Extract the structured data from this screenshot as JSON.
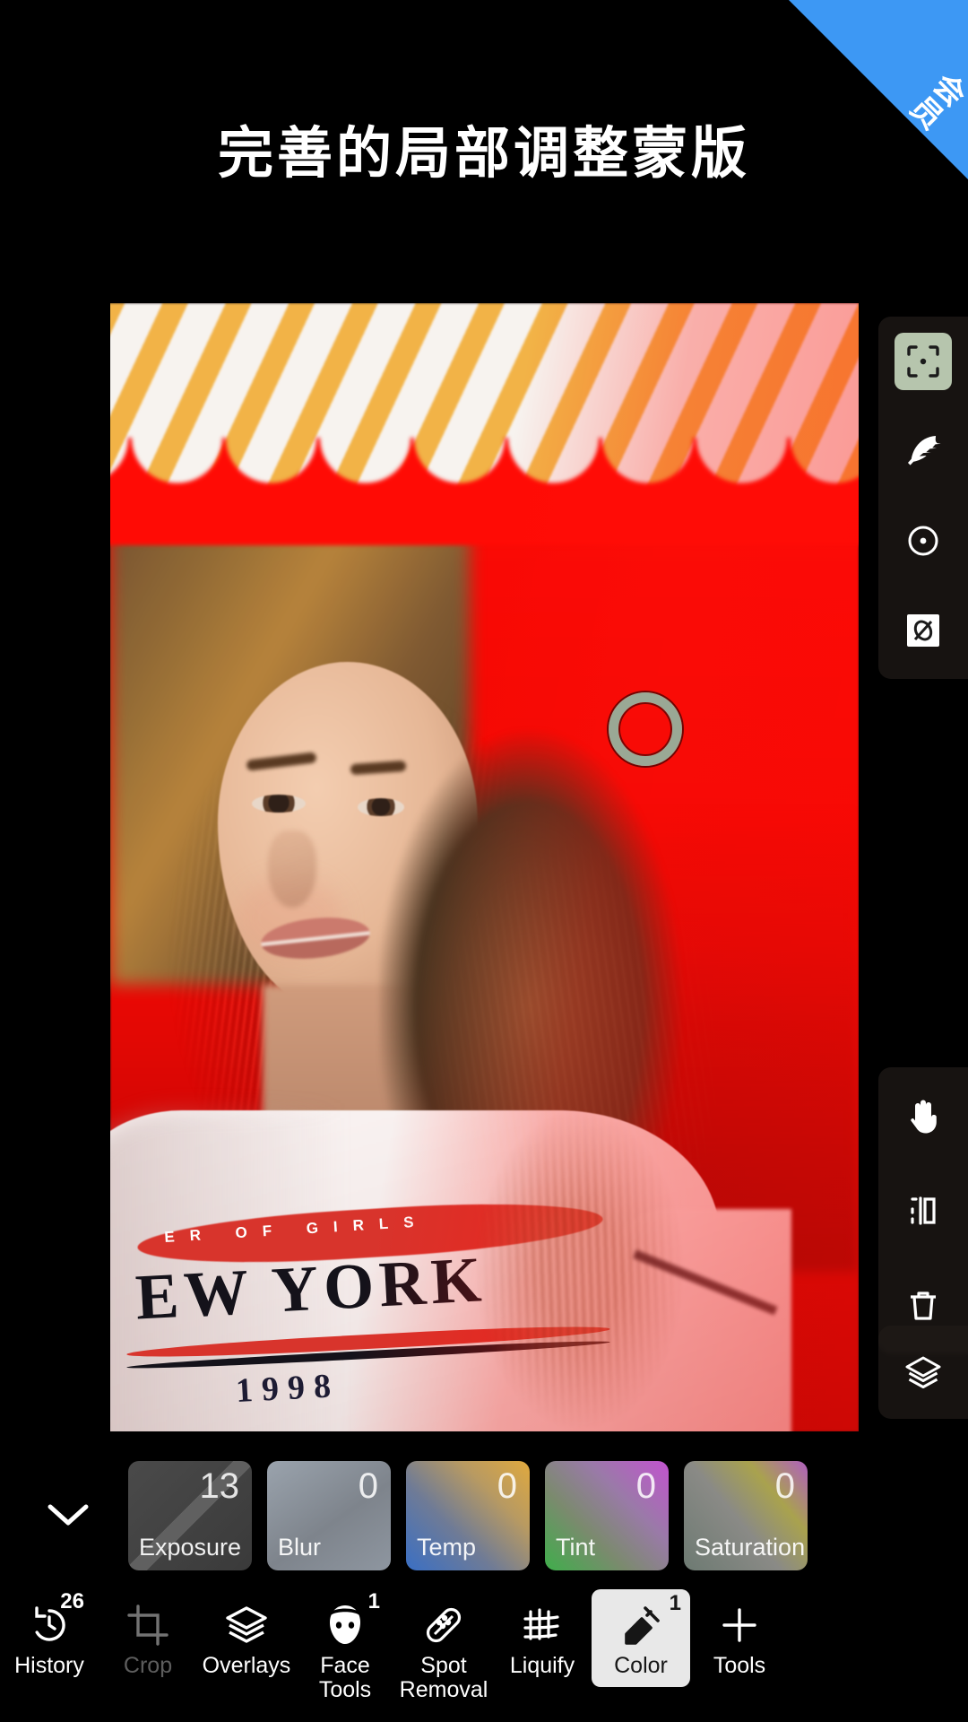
{
  "ribbon": {
    "label": "会员",
    "color": "#3d98f4"
  },
  "headline": {
    "text": "完善的局部调整蒙版"
  },
  "photo": {
    "tee_small_text": "ER OF GIRLS",
    "tee_main_text": "EW YORK",
    "tee_year": "1998"
  },
  "mask_toolbar": {
    "items": [
      {
        "name": "target-mask",
        "icon": "target-icon",
        "selected": true
      },
      {
        "name": "feather",
        "icon": "feather-icon",
        "selected": false
      },
      {
        "name": "radial-mask",
        "icon": "circle-dot-icon",
        "selected": false
      },
      {
        "name": "invert-mask",
        "icon": "invert-icon",
        "selected": false
      }
    ]
  },
  "transform_toolbar": {
    "items": [
      {
        "name": "pan",
        "icon": "hand-icon"
      },
      {
        "name": "mirror",
        "icon": "mirror-icon"
      },
      {
        "name": "delete",
        "icon": "trash-icon"
      }
    ]
  },
  "layers_button": {
    "name": "layers",
    "icon": "layers-icon"
  },
  "adjustments": {
    "collapse_icon": "chevron-down-icon",
    "cards": [
      {
        "label": "Exposure",
        "value": "13",
        "swatch": "exposure",
        "disabled": true
      },
      {
        "label": "Blur",
        "value": "0",
        "swatch": "blur",
        "disabled": false
      },
      {
        "label": "Temp",
        "value": "0",
        "swatch": "temp",
        "disabled": false
      },
      {
        "label": "Tint",
        "value": "0",
        "swatch": "tint",
        "disabled": false
      },
      {
        "label": "Saturation",
        "value": "0",
        "swatch": "saturation",
        "disabled": false
      }
    ]
  },
  "bottom_nav": {
    "items": [
      {
        "label": "History",
        "icon": "history-icon",
        "badge": "26",
        "active": false,
        "faded": false
      },
      {
        "label": "Crop",
        "icon": "crop-icon",
        "badge": "",
        "active": false,
        "faded": true
      },
      {
        "label": "Overlays",
        "icon": "overlays-icon",
        "badge": "",
        "active": false,
        "faded": false
      },
      {
        "label": "Face\nTools",
        "icon": "face-tools-icon",
        "badge": "1",
        "active": false,
        "faded": false
      },
      {
        "label": "Spot\nRemoval",
        "icon": "spot-removal-icon",
        "badge": "",
        "active": false,
        "faded": false
      },
      {
        "label": "Liquify",
        "icon": "liquify-icon",
        "badge": "",
        "active": false,
        "faded": false
      },
      {
        "label": "Color",
        "icon": "eyedropper-icon",
        "badge": "1",
        "active": true,
        "faded": false
      },
      {
        "label": "Tools",
        "icon": "plus-icon",
        "badge": "",
        "active": false,
        "faded": false
      }
    ]
  }
}
